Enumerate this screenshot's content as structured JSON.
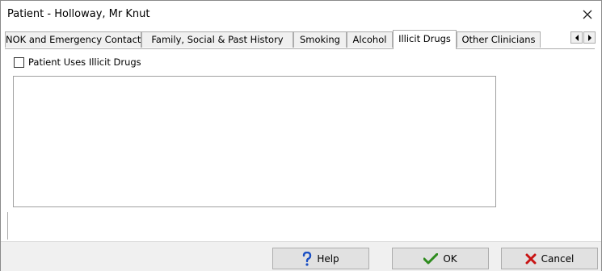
{
  "window": {
    "title": "Patient - Holloway, Mr Knut"
  },
  "tabs": [
    {
      "label": "NOK and Emergency Contact",
      "active": false
    },
    {
      "label": "Family, Social & Past History",
      "active": false
    },
    {
      "label": "Smoking",
      "active": false
    },
    {
      "label": "Alcohol",
      "active": false
    },
    {
      "label": "Illicit Drugs",
      "active": true
    },
    {
      "label": "Other Clinicians",
      "active": false
    }
  ],
  "illicit_drugs": {
    "checkbox_label": "Patient Uses Illicit Drugs",
    "checked": false,
    "notes": ""
  },
  "buttons": {
    "help": "Help",
    "ok": "OK",
    "cancel": "Cancel"
  },
  "icons": {
    "help": "question-mark-icon",
    "ok": "checkmark-icon",
    "cancel": "x-icon",
    "close": "close-icon",
    "scroll_left": "chevron-left-icon",
    "scroll_right": "chevron-right-icon"
  },
  "colors": {
    "help_icon": "#1a4fc4",
    "ok_icon": "#2e8b1e",
    "cancel_icon": "#c81414"
  }
}
